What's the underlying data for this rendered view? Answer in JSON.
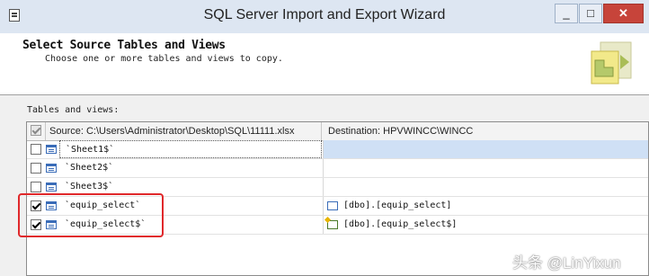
{
  "window": {
    "title": "SQL Server Import and Export Wizard",
    "minimize": "_",
    "maximize": "□",
    "close": "✕"
  },
  "header": {
    "title": "Select Source Tables and Views",
    "subtitle": "Choose one or more tables and views to copy."
  },
  "section_label": "Tables and views:",
  "grid": {
    "source_header": "Source: C:\\Users\\Administrator\\Desktop\\SQL\\11111.xlsx",
    "destination_header": "Destination: HPVWINCC\\WINCC",
    "rows": [
      {
        "checked": false,
        "source": "`Sheet1$`",
        "destination": "",
        "selected": true
      },
      {
        "checked": false,
        "source": "`Sheet2$`",
        "destination": ""
      },
      {
        "checked": false,
        "source": "`Sheet3$`",
        "destination": ""
      },
      {
        "checked": true,
        "source": "`equip_select`",
        "destination": "[dbo].[equip_select]"
      },
      {
        "checked": true,
        "source": "`equip_select$`",
        "destination": "[dbo].[equip_select$]"
      }
    ]
  },
  "watermark": "头条 @LinYixun",
  "colors": {
    "highlight": "#e0282b",
    "selection": "#cfe0f5",
    "close_button": "#c7443a"
  }
}
